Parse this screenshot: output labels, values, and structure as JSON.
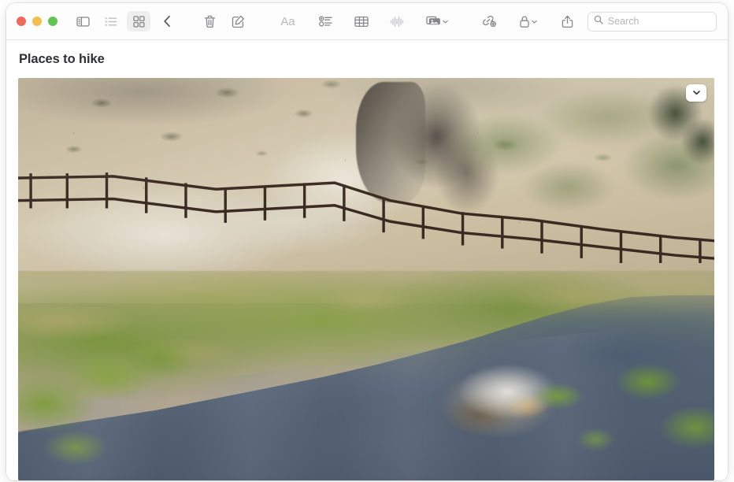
{
  "window": {
    "app": "Notes",
    "traffic_lights": [
      {
        "name": "close",
        "color": "#ef6a5e"
      },
      {
        "name": "minimize",
        "color": "#f4bd4f"
      },
      {
        "name": "maximize",
        "color": "#61c454"
      }
    ]
  },
  "toolbar": {
    "items": [
      {
        "name": "sidebar-toggle",
        "icon": "sidebar-icon",
        "label": "Show Folders",
        "state": "normal"
      },
      {
        "name": "list-view",
        "icon": "list-view-icon",
        "label": "List View",
        "state": "normal"
      },
      {
        "name": "gallery-view",
        "icon": "gallery-view-icon",
        "label": "Gallery View",
        "state": "selected"
      },
      {
        "name": "back",
        "icon": "chevron-left-icon",
        "label": "Back",
        "state": "normal"
      },
      {
        "name": "delete",
        "icon": "trash-icon",
        "label": "Delete",
        "state": "normal"
      },
      {
        "name": "compose",
        "icon": "compose-icon",
        "label": "New Note",
        "state": "normal"
      },
      {
        "name": "format",
        "icon": "format-aa-icon",
        "label": "Aa",
        "state": "normal"
      },
      {
        "name": "checklist",
        "icon": "checklist-icon",
        "label": "Checklist",
        "state": "normal"
      },
      {
        "name": "table",
        "icon": "table-icon",
        "label": "Table",
        "state": "normal"
      },
      {
        "name": "audio",
        "icon": "waveform-icon",
        "label": "Record Audio",
        "state": "disabled"
      },
      {
        "name": "media",
        "icon": "media-stack-icon",
        "label": "Media",
        "state": "normal",
        "has_chevron": true
      },
      {
        "name": "collaborate",
        "icon": "link-add-icon",
        "label": "Add People",
        "state": "normal"
      },
      {
        "name": "lock",
        "icon": "lock-icon",
        "label": "Lock Note",
        "state": "normal",
        "has_chevron": true
      },
      {
        "name": "share",
        "icon": "share-icon",
        "label": "Share",
        "state": "normal"
      }
    ],
    "format_label": "Aa"
  },
  "search": {
    "placeholder": "Search",
    "value": "",
    "icon": "search-icon"
  },
  "note": {
    "title": "Places to hike",
    "attachment": {
      "name": "landscape-photo",
      "alt": "Hot springs creek with a wooden fence along a dry hillside, green meadow and blue-gray stream",
      "overlay_button": {
        "name": "attachment-options-button",
        "icon": "chevron-down-icon"
      }
    }
  }
}
